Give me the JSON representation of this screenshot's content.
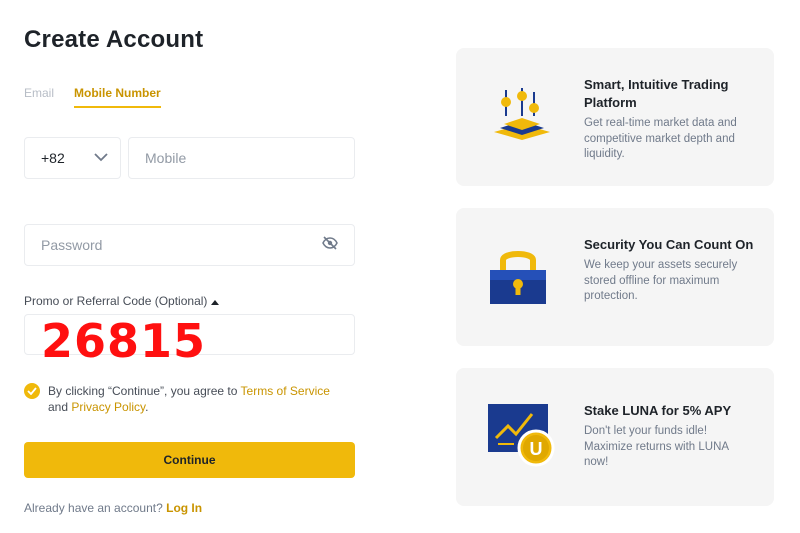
{
  "page": {
    "title": "Create Account"
  },
  "tabs": [
    {
      "label": "Email",
      "active": false
    },
    {
      "label": "Mobile Number",
      "active": true
    }
  ],
  "form": {
    "country_code": "+82",
    "mobile_placeholder": "Mobile",
    "password_placeholder": "Password",
    "promo_label": "Promo or Referral Code (Optional)",
    "promo_value": "26815",
    "agree_prefix": "By clicking “Continue”, you agree to ",
    "terms_link": "Terms of Service",
    "agree_and": "and ",
    "privacy_link": "Privacy Policy",
    "agree_suffix": ".",
    "continue_label": "Continue",
    "already_text": "Already have an account? ",
    "login_link": "Log In"
  },
  "features": [
    {
      "icon": "trading-platform-icon",
      "heading": "Smart, Intuitive Trading Platform",
      "description": "Get real-time market data and competitive market depth and liquidity."
    },
    {
      "icon": "padlock-icon",
      "heading": "Security You Can Count On",
      "description": "We keep your assets securely stored offline for maximum protection."
    },
    {
      "icon": "luna-staking-icon",
      "heading": "Stake LUNA for 5% APY",
      "description": "Don't let your funds idle! Maximize returns with LUNA now!"
    }
  ],
  "colors": {
    "accent": "#f0b90b",
    "link": "#c99400",
    "promo_code": "#ff1010",
    "card_bg": "#f5f5f5",
    "icon_navy": "#1a3a8f"
  }
}
